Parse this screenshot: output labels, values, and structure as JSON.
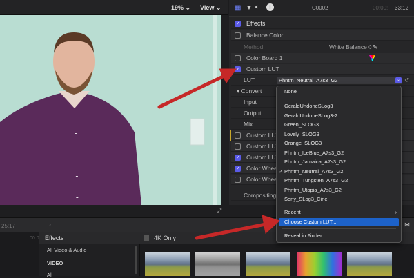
{
  "viewer": {
    "zoom": "19%",
    "view": "View"
  },
  "inspector": {
    "clip": "C0002",
    "timecode_dim": "00:00:",
    "timecode": "33:12",
    "effects_label": "Effects",
    "rows": [
      {
        "label": "Balance Color",
        "checked": false
      },
      {
        "label": "Method",
        "value": "White Balance ◊"
      },
      {
        "label": "Color Board 1",
        "checked": false
      },
      {
        "label": "Custom LUT",
        "checked": true
      },
      {
        "label": "LUT",
        "value": "Phntm_Neutral_A7s3_G2"
      },
      {
        "label": "Convert"
      },
      {
        "label": "Input"
      },
      {
        "label": "Output"
      },
      {
        "label": "Mix"
      },
      {
        "label": "Custom LUT",
        "checked": false
      },
      {
        "label": "Custom LUT",
        "checked": false
      },
      {
        "label": "Custom LUT",
        "checked": true
      },
      {
        "label": "Color Wheels",
        "checked": true
      },
      {
        "label": "Color Wheels",
        "checked": false
      },
      {
        "label": "Compositing"
      }
    ]
  },
  "menu": {
    "none": "None",
    "items": [
      "GeraldUndoneSLog3",
      "GeraldUndoneSLog3-2",
      "Green_SLOG3",
      "Lovely_SLOG3",
      "Orange_SLOG3",
      "Phntm_IceBlue_A7s3_G2",
      "Phntm_Jamaica_A7s3_G2",
      "Phntm_Neutral_A7s3_G2",
      "Phntm_Tungsten_A7s3_G2",
      "Phntm_Utopia_A7s3_G2",
      "Sony_SLog3_Cine"
    ],
    "selected": "Phntm_Neutral_A7s3_G2",
    "recent": "Recent",
    "choose": "Choose Custom LUT...",
    "reveal": "Reveal in Finder"
  },
  "timeline": {
    "timecode": "25:17",
    "ruler": "00:0"
  },
  "browser": {
    "title": "Effects",
    "filter": "4K Only",
    "sidebar": [
      "All Video & Audio",
      "VIDEO",
      "All"
    ]
  },
  "colors": {
    "accent": "#5b5be8",
    "highlight": "#1d62c9",
    "arrow": "#c62828"
  }
}
